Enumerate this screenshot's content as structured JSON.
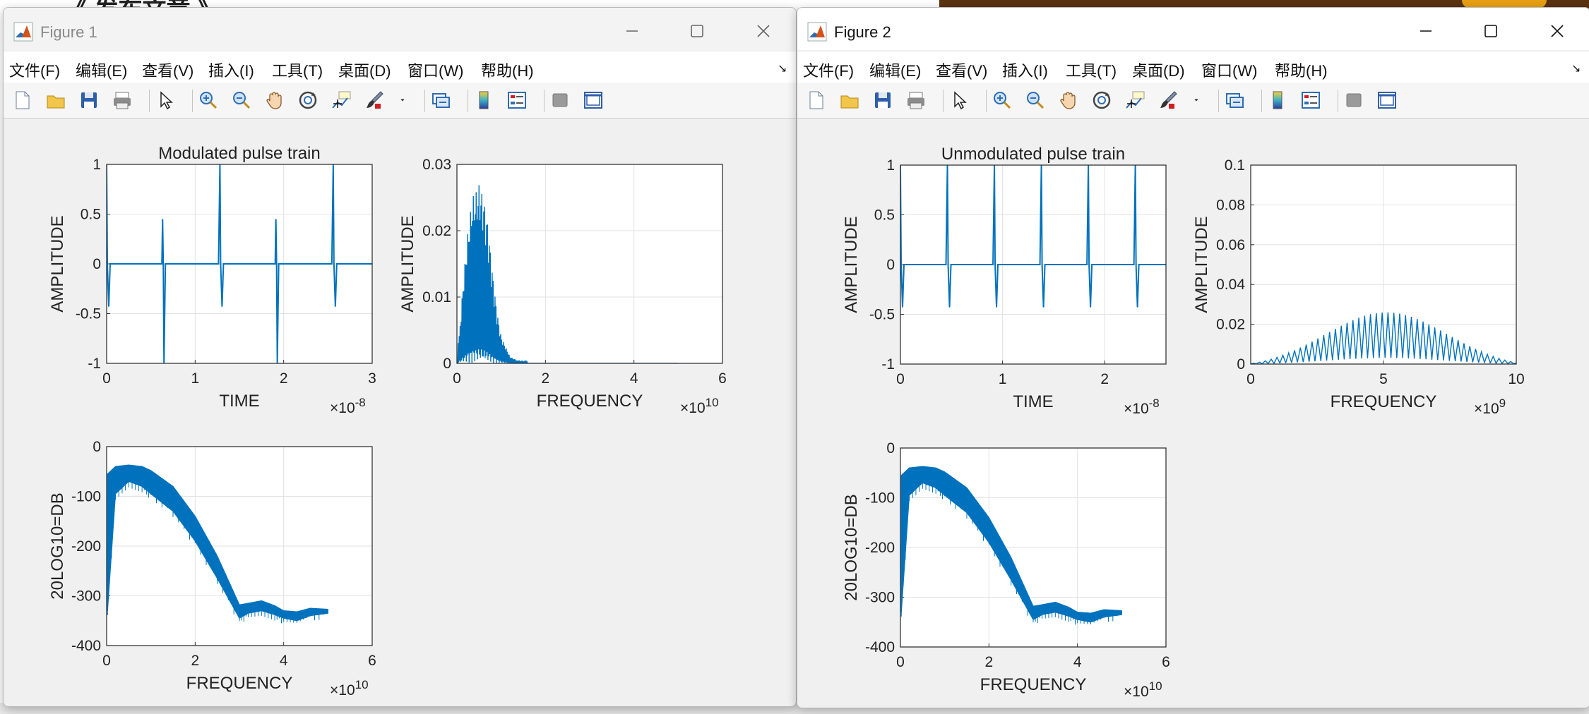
{
  "background": {
    "heading": "《 发布文章 》"
  },
  "windows": [
    {
      "id": "fig1",
      "title": "Figure 1",
      "menu": [
        "文件(F)",
        "编辑(E)",
        "查看(V)",
        "插入(I)",
        "工具(T)",
        "桌面(D)",
        "窗口(W)",
        "帮助(H)"
      ],
      "menu_arrow": "↘",
      "toolbar": [
        "new-file-icon",
        "open-folder-icon",
        "save-icon",
        "print-icon",
        "|",
        "pointer-icon",
        "|",
        "zoom-in-icon",
        "zoom-out-icon",
        "pan-hand-icon",
        "rotate-3d-icon",
        "data-cursor-icon",
        "brush-icon",
        "brush-dropdown-icon",
        "|",
        "link-plot-icon",
        "|",
        "colorbar-icon",
        "legend-icon",
        "|",
        "hide-plot-tools-icon",
        "show-plot-tools-icon"
      ]
    },
    {
      "id": "fig2",
      "title": "Figure 2",
      "menu": [
        "文件(F)",
        "编辑(E)",
        "查看(V)",
        "插入(I)",
        "工具(T)",
        "桌面(D)",
        "窗口(W)",
        "帮助(H)"
      ],
      "menu_arrow": "↘",
      "toolbar": [
        "new-file-icon",
        "open-folder-icon",
        "save-icon",
        "print-icon",
        "|",
        "pointer-icon",
        "|",
        "zoom-in-icon",
        "zoom-out-icon",
        "pan-hand-icon",
        "rotate-3d-icon",
        "data-cursor-icon",
        "brush-icon",
        "brush-dropdown-icon",
        "|",
        "link-plot-icon",
        "|",
        "colorbar-icon",
        "legend-icon",
        "|",
        "hide-plot-tools-icon",
        "show-plot-tools-icon"
      ]
    }
  ],
  "colors": {
    "series": "#0072BD",
    "axes_bg": "#ffffff",
    "figure_bg": "#f0f0f0",
    "grid": "#e2e2e2"
  },
  "chart_data": [
    {
      "window": "fig1",
      "type": "line",
      "kind": "pulse-time",
      "title": "Modulated pulse train",
      "xlabel": "TIME",
      "ylabel": "AMPLITUDE",
      "xlim": [
        0,
        3
      ],
      "ylim": [
        -1,
        1
      ],
      "xticks": [
        "0",
        "1",
        "2",
        "3"
      ],
      "yticks": [
        "-1",
        "-0.5",
        "0",
        "0.5",
        "1"
      ],
      "exponent": {
        "base": "×10",
        "power": "-8"
      },
      "pulses": [
        {
          "x": 0.0,
          "peak": 1,
          "trough": -0.43
        },
        {
          "x": 0.64,
          "peak": 0.45,
          "trough": -1
        },
        {
          "x": 1.28,
          "peak": 1,
          "trough": -0.43
        },
        {
          "x": 1.92,
          "peak": 0.45,
          "trough": -1
        },
        {
          "x": 2.56,
          "peak": 1,
          "trough": -0.43
        }
      ]
    },
    {
      "window": "fig1",
      "type": "line",
      "kind": "spectrum-band",
      "title": "",
      "xlabel": "FREQUENCY",
      "ylabel": "AMPLITUDE",
      "xlim": [
        0,
        6
      ],
      "ylim": [
        0,
        0.03
      ],
      "xticks": [
        "0",
        "2",
        "4",
        "6"
      ],
      "yticks": [
        "0",
        "0.01",
        "0.02",
        "0.03"
      ],
      "exponent": {
        "base": "×10",
        "power": "10"
      },
      "envelope": {
        "x": [
          0.05,
          0.15,
          0.25,
          0.35,
          0.45,
          0.5,
          0.55,
          0.6,
          0.7,
          0.8,
          0.9,
          1.0,
          1.2,
          1.4,
          5.0
        ],
        "y": [
          0.004,
          0.013,
          0.02,
          0.025,
          0.026,
          0.027,
          0.026,
          0.025,
          0.021,
          0.014,
          0.008,
          0.004,
          0.001,
          0.0003,
          0.0
        ]
      }
    },
    {
      "window": "fig1",
      "type": "line",
      "kind": "db-band",
      "title": "",
      "xlabel": "FREQUENCY",
      "ylabel": "20LOG10=DB",
      "xlim": [
        0,
        6
      ],
      "ylim": [
        -400,
        0
      ],
      "xticks": [
        "0",
        "2",
        "4",
        "6"
      ],
      "yticks": [
        "-400",
        "-300",
        "-200",
        "-100",
        "0"
      ],
      "exponent": {
        "base": "×10",
        "power": "10"
      },
      "upper": {
        "x": [
          0.02,
          0.2,
          0.5,
          0.8,
          1.0,
          1.5,
          2.0,
          2.5,
          3.0,
          3.2,
          3.5,
          3.8,
          4.0,
          4.3,
          4.6,
          5.0
        ],
        "y": [
          -55,
          -40,
          -37,
          -40,
          -48,
          -80,
          -140,
          -220,
          -318,
          -315,
          -310,
          -320,
          -330,
          -332,
          -325,
          -327
        ]
      },
      "lower": {
        "x": [
          0.02,
          0.2,
          0.5,
          0.8,
          1.0,
          1.5,
          2.0,
          2.5,
          3.0,
          3.2,
          3.5,
          3.8,
          4.0,
          4.3,
          4.6,
          5.0
        ],
        "y": [
          -330,
          -95,
          -70,
          -80,
          -95,
          -130,
          -190,
          -265,
          -345,
          -335,
          -330,
          -338,
          -345,
          -350,
          -340,
          -335
        ]
      }
    },
    {
      "window": "fig2",
      "type": "line",
      "kind": "pulse-time",
      "title": "Unmodulated pulse train",
      "xlabel": "TIME",
      "ylabel": "AMPLITUDE",
      "xlim": [
        0,
        2.6
      ],
      "ylim": [
        -1,
        1
      ],
      "xticks": [
        "0",
        "1",
        "2"
      ],
      "yticks": [
        "-1",
        "-0.5",
        "0",
        "0.5",
        "1"
      ],
      "exponent": {
        "base": "×10",
        "power": "-8"
      },
      "pulses": [
        {
          "x": 0.0,
          "peak": 1,
          "trough": -0.43
        },
        {
          "x": 0.46,
          "peak": 1,
          "trough": -0.43
        },
        {
          "x": 0.92,
          "peak": 1,
          "trough": -0.43
        },
        {
          "x": 1.38,
          "peak": 1,
          "trough": -0.43
        },
        {
          "x": 1.84,
          "peak": 1,
          "trough": -0.43
        },
        {
          "x": 2.3,
          "peak": 1,
          "trough": -0.43
        }
      ]
    },
    {
      "window": "fig2",
      "type": "line",
      "kind": "spectrum-comb",
      "title": "",
      "xlabel": "FREQUENCY",
      "ylabel": "AMPLITUDE",
      "xlim": [
        0,
        10
      ],
      "ylim": [
        0,
        0.1
      ],
      "xticks": [
        "0",
        "5",
        "10"
      ],
      "yticks": [
        "0",
        "0.02",
        "0.04",
        "0.06",
        "0.08",
        "0.1"
      ],
      "exponent": {
        "base": "×10",
        "power": "9"
      },
      "comb": {
        "center": 5.0,
        "peak": 0.026,
        "sigma": 2.2,
        "spacing": 0.22
      }
    },
    {
      "window": "fig2",
      "type": "line",
      "kind": "db-band",
      "title": "",
      "xlabel": "FREQUENCY",
      "ylabel": "20LOG10=DB",
      "xlim": [
        0,
        6
      ],
      "ylim": [
        -400,
        0
      ],
      "xticks": [
        "0",
        "2",
        "4",
        "6"
      ],
      "yticks": [
        "-400",
        "-300",
        "-200",
        "-100",
        "0"
      ],
      "exponent": {
        "base": "×10",
        "power": "10"
      },
      "upper": {
        "x": [
          0.02,
          0.2,
          0.5,
          0.8,
          1.0,
          1.5,
          2.0,
          2.5,
          3.0,
          3.2,
          3.5,
          3.8,
          4.0,
          4.3,
          4.6,
          5.0
        ],
        "y": [
          -55,
          -40,
          -37,
          -40,
          -48,
          -80,
          -140,
          -220,
          -318,
          -315,
          -310,
          -320,
          -330,
          -332,
          -325,
          -327
        ]
      },
      "lower": {
        "x": [
          0.02,
          0.2,
          0.5,
          0.8,
          1.0,
          1.5,
          2.0,
          2.5,
          3.0,
          3.2,
          3.5,
          3.8,
          4.0,
          4.3,
          4.6,
          5.0
        ],
        "y": [
          -330,
          -95,
          -70,
          -80,
          -95,
          -130,
          -190,
          -265,
          -345,
          -335,
          -330,
          -338,
          -345,
          -350,
          -340,
          -335
        ]
      }
    }
  ]
}
